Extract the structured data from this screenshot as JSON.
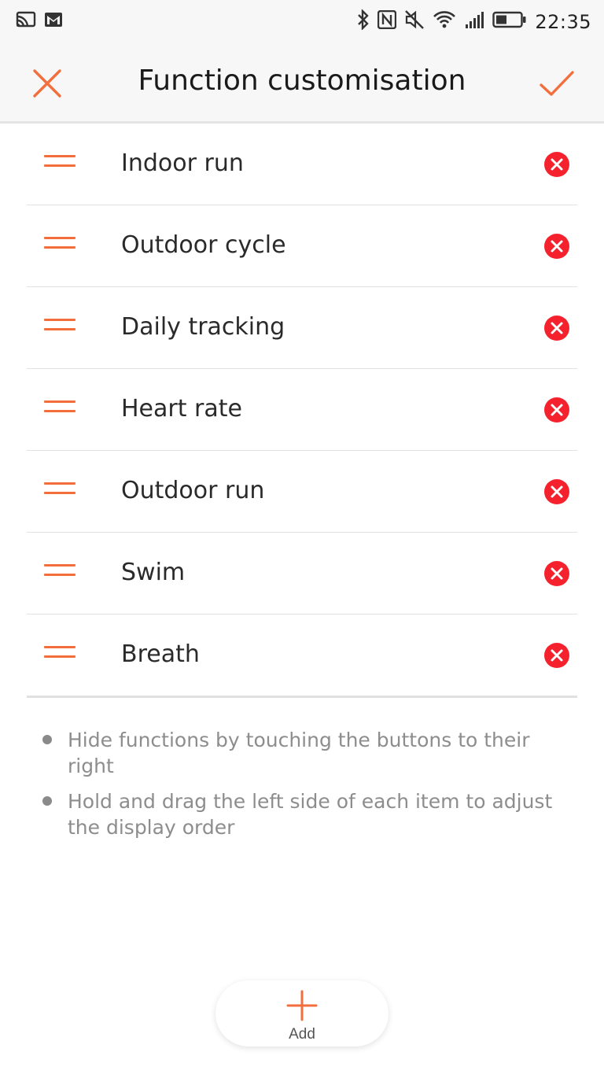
{
  "status_bar": {
    "time": "22:35",
    "icons": [
      "cast-icon",
      "gmail-icon",
      "bluetooth-icon",
      "nfc-icon",
      "mute-icon",
      "wifi-icon",
      "signal-icon",
      "battery-icon"
    ]
  },
  "header": {
    "title": "Function customisation",
    "close_icon": "close-icon",
    "confirm_icon": "checkmark-icon"
  },
  "functions": [
    {
      "label": "Indoor run"
    },
    {
      "label": "Outdoor cycle"
    },
    {
      "label": "Daily tracking"
    },
    {
      "label": "Heart rate"
    },
    {
      "label": "Outdoor run"
    },
    {
      "label": "Swim"
    },
    {
      "label": "Breath"
    }
  ],
  "hints": [
    "Hide functions by touching the buttons to their right",
    "Hold and drag the left side of each item to adjust the display order"
  ],
  "add_button": {
    "label": "Add"
  },
  "colors": {
    "accent": "#f26f3d",
    "remove": "#f5222d",
    "hint_text": "#8d8d8d"
  }
}
